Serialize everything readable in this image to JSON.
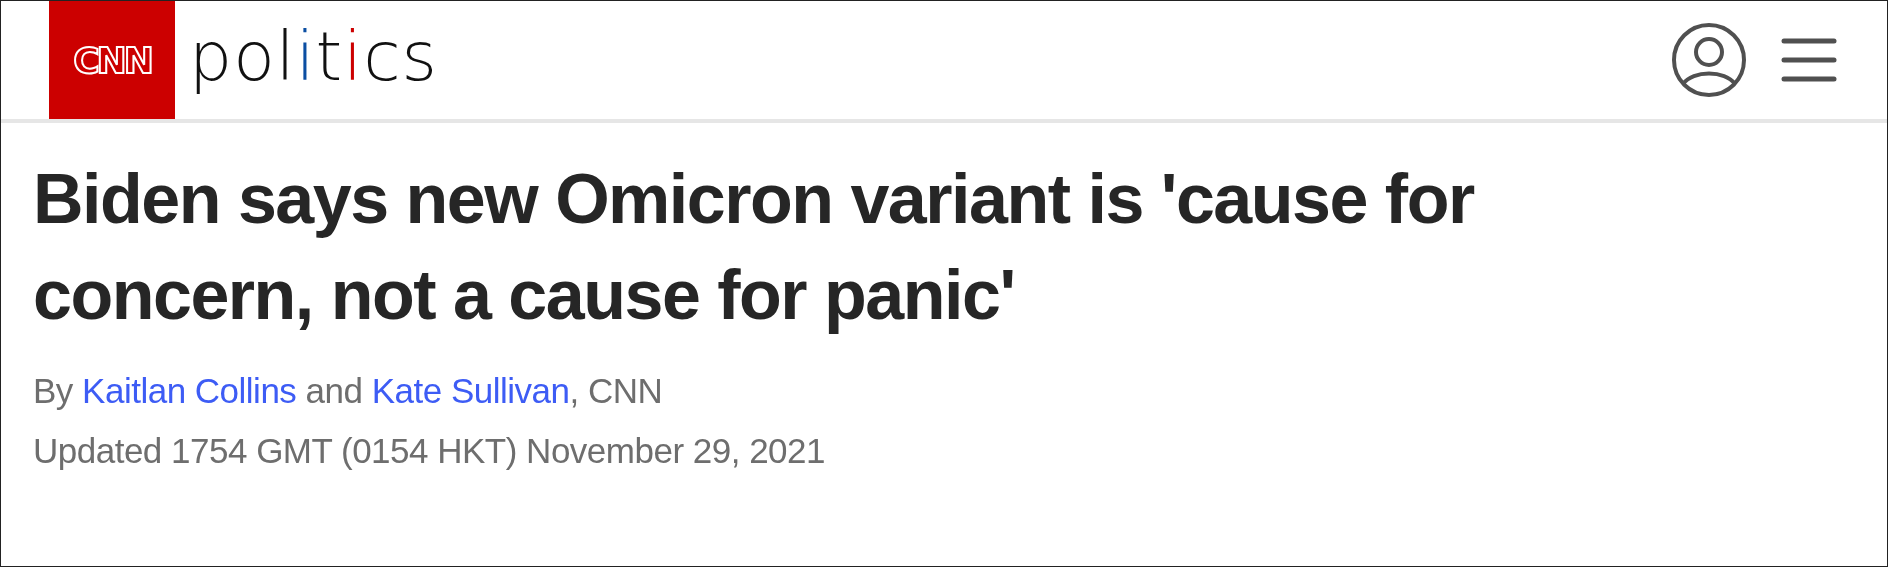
{
  "header": {
    "logo": "CNN",
    "section_wordmark": [
      {
        "text": "pol",
        "color": "#111111"
      },
      {
        "text": "i",
        "color": "#0b4ea2"
      },
      {
        "text": "t",
        "color": "#111111"
      },
      {
        "text": "i",
        "color": "#cc0000"
      },
      {
        "text": "cs",
        "color": "#111111"
      }
    ]
  },
  "headline": "Biden says new Omicron variant is 'cause for concern, not a cause for panic'",
  "byline": [
    {
      "kind": "text",
      "text": "By "
    },
    {
      "kind": "link",
      "text": "Kaitlan Collins"
    },
    {
      "kind": "text",
      "text": " and "
    },
    {
      "kind": "link",
      "text": "Kate Sullivan"
    },
    {
      "kind": "text",
      "text": ", CNN"
    }
  ],
  "updated": "Updated 1754 GMT (0154 HKT) November 29, 2021"
}
